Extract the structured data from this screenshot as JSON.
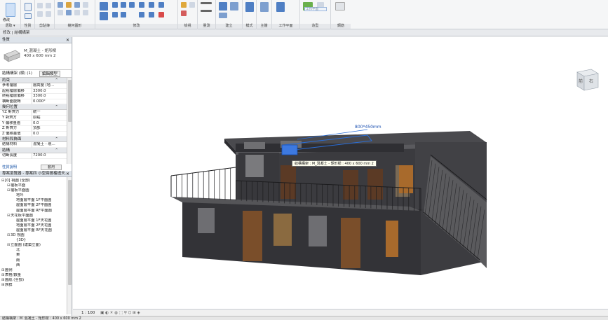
{
  "ribbon": {
    "groups": [
      {
        "label": "選取 ▾"
      },
      {
        "label": "性質"
      },
      {
        "label": "剪貼簿"
      },
      {
        "label": "幾何圖形"
      },
      {
        "label": "修改"
      },
      {
        "label": "檢視"
      },
      {
        "label": "量測"
      },
      {
        "label": "建立"
      },
      {
        "label": "模式"
      },
      {
        "label": "主體"
      },
      {
        "label": "工作平面"
      },
      {
        "label": "造型"
      },
      {
        "label": "鋼筋"
      }
    ],
    "modify_label": "修改",
    "workplane_hint": "工作平面"
  },
  "tabbar": {
    "text": "修改 | 結構構架"
  },
  "properties": {
    "header": "性質",
    "type_name_line1": "M_混凝土 - 矩形樑",
    "type_name_line2": "400 x 600 mm 2",
    "type_selector": "結構構架 (樑) (1)",
    "edit_type_label": "編輯類型",
    "sections": [
      {
        "title": "約束",
        "rows": [
          {
            "k": "參考樓層",
            "v": "層高度 (地…"
          },
          {
            "k": "起點樓層偏移",
            "v": "3300.0"
          },
          {
            "k": "終點樓層偏移",
            "v": "3300.0"
          },
          {
            "k": "橫斷面旋轉",
            "v": "0.000°"
          }
        ]
      },
      {
        "title": "幾何位置",
        "rows": [
          {
            "k": "YZ 對齊方",
            "v": "統一"
          },
          {
            "k": "Y 對齊方",
            "v": "原點"
          },
          {
            "k": "Y 偏移量值",
            "v": "0.0"
          },
          {
            "k": "Z 對齊方",
            "v": "頂部"
          },
          {
            "k": "Z 偏移量值",
            "v": "0.0"
          }
        ]
      },
      {
        "title": "材料和飾面",
        "rows": [
          {
            "k": "結構材料",
            "v": "混凝土 - 現…"
          }
        ]
      },
      {
        "title": "結構",
        "rows": [
          {
            "k": "切斷長度",
            "v": "7200.0"
          }
        ]
      }
    ],
    "help_link": "性質說明",
    "apply_label": "套用"
  },
  "browser": {
    "header": "專案瀏覽器 - 專案四 小型兩層樓透天…",
    "items": [
      {
        "indent": 0,
        "toggle": "⊟",
        "label": "[0] 視圖 (全部)"
      },
      {
        "indent": 1,
        "toggle": "⊟",
        "label": "樓板平面"
      },
      {
        "indent": 1,
        "toggle": "⊟",
        "label": "樓板平面圖"
      },
      {
        "indent": 2,
        "toggle": "",
        "label": "地坪"
      },
      {
        "indent": 2,
        "toggle": "",
        "label": "地面層平面 1F平面圖"
      },
      {
        "indent": 2,
        "toggle": "",
        "label": "屋面層平面 2F平面圖"
      },
      {
        "indent": 2,
        "toggle": "",
        "label": "屋面層平面 RF平面圖"
      },
      {
        "indent": 1,
        "toggle": "⊟",
        "label": "天花板平面圖"
      },
      {
        "indent": 2,
        "toggle": "",
        "label": "屋面層平面 1F天花圖"
      },
      {
        "indent": 2,
        "toggle": "",
        "label": "地面層平面 2F天花圖"
      },
      {
        "indent": 2,
        "toggle": "",
        "label": "屋面層平面 RF天花圖"
      },
      {
        "indent": 1,
        "toggle": "⊟",
        "label": "3D 視圖"
      },
      {
        "indent": 2,
        "toggle": "",
        "label": "{3D}"
      },
      {
        "indent": 1,
        "toggle": "⊟",
        "label": "立面圖 (建築立面)"
      },
      {
        "indent": 2,
        "toggle": "",
        "label": "北"
      },
      {
        "indent": 2,
        "toggle": "",
        "label": "東"
      },
      {
        "indent": 2,
        "toggle": "",
        "label": "南"
      },
      {
        "indent": 2,
        "toggle": "",
        "label": "西"
      },
      {
        "indent": 0,
        "toggle": "⊞",
        "label": "圖例"
      },
      {
        "indent": 0,
        "toggle": "⊞",
        "label": "表格/數量"
      },
      {
        "indent": 0,
        "toggle": "⊞",
        "label": "圖紙 (全部)"
      },
      {
        "indent": 0,
        "toggle": "⊞",
        "label": "族群"
      }
    ]
  },
  "canvas": {
    "tooltip": "結構構架 : M_混凝土 - 矩形樑 : 400 x 600 mm 2",
    "dimension_label": "800*450mm",
    "viewcube_left": "前",
    "viewcube_right": "右"
  },
  "viewctrl": {
    "scale": "1 : 100"
  },
  "statusbar": {
    "text": "結構構架 : M_混凝土 - 矩形樑 : 400 x 600 mm 2"
  },
  "colors": {
    "accent": "#1a6fd0",
    "selected": "#2a6ed8",
    "building_dark": "#3a3a3e"
  }
}
